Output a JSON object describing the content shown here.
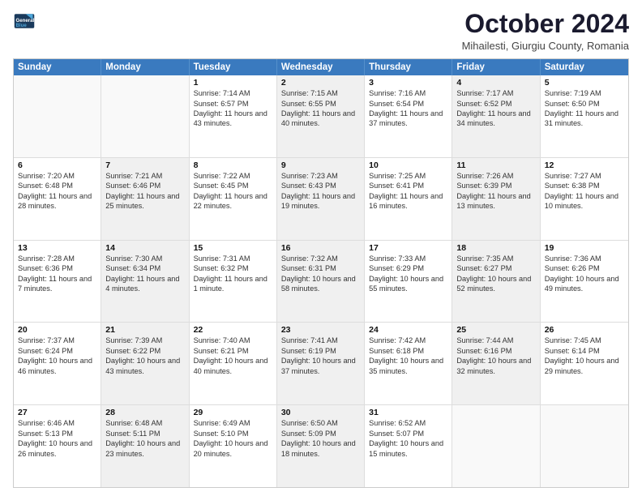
{
  "logo": {
    "line1": "General",
    "line2": "Blue"
  },
  "title": "October 2024",
  "subtitle": "Mihailesti, Giurgiu County, Romania",
  "header_days": [
    "Sunday",
    "Monday",
    "Tuesday",
    "Wednesday",
    "Thursday",
    "Friday",
    "Saturday"
  ],
  "weeks": [
    [
      {
        "day": "",
        "sunrise": "",
        "sunset": "",
        "daylight": "",
        "shaded": false,
        "empty": true
      },
      {
        "day": "",
        "sunrise": "",
        "sunset": "",
        "daylight": "",
        "shaded": false,
        "empty": true
      },
      {
        "day": "1",
        "sunrise": "Sunrise: 7:14 AM",
        "sunset": "Sunset: 6:57 PM",
        "daylight": "Daylight: 11 hours and 43 minutes.",
        "shaded": false,
        "empty": false
      },
      {
        "day": "2",
        "sunrise": "Sunrise: 7:15 AM",
        "sunset": "Sunset: 6:55 PM",
        "daylight": "Daylight: 11 hours and 40 minutes.",
        "shaded": true,
        "empty": false
      },
      {
        "day": "3",
        "sunrise": "Sunrise: 7:16 AM",
        "sunset": "Sunset: 6:54 PM",
        "daylight": "Daylight: 11 hours and 37 minutes.",
        "shaded": false,
        "empty": false
      },
      {
        "day": "4",
        "sunrise": "Sunrise: 7:17 AM",
        "sunset": "Sunset: 6:52 PM",
        "daylight": "Daylight: 11 hours and 34 minutes.",
        "shaded": true,
        "empty": false
      },
      {
        "day": "5",
        "sunrise": "Sunrise: 7:19 AM",
        "sunset": "Sunset: 6:50 PM",
        "daylight": "Daylight: 11 hours and 31 minutes.",
        "shaded": false,
        "empty": false
      }
    ],
    [
      {
        "day": "6",
        "sunrise": "Sunrise: 7:20 AM",
        "sunset": "Sunset: 6:48 PM",
        "daylight": "Daylight: 11 hours and 28 minutes.",
        "shaded": false,
        "empty": false
      },
      {
        "day": "7",
        "sunrise": "Sunrise: 7:21 AM",
        "sunset": "Sunset: 6:46 PM",
        "daylight": "Daylight: 11 hours and 25 minutes.",
        "shaded": true,
        "empty": false
      },
      {
        "day": "8",
        "sunrise": "Sunrise: 7:22 AM",
        "sunset": "Sunset: 6:45 PM",
        "daylight": "Daylight: 11 hours and 22 minutes.",
        "shaded": false,
        "empty": false
      },
      {
        "day": "9",
        "sunrise": "Sunrise: 7:23 AM",
        "sunset": "Sunset: 6:43 PM",
        "daylight": "Daylight: 11 hours and 19 minutes.",
        "shaded": true,
        "empty": false
      },
      {
        "day": "10",
        "sunrise": "Sunrise: 7:25 AM",
        "sunset": "Sunset: 6:41 PM",
        "daylight": "Daylight: 11 hours and 16 minutes.",
        "shaded": false,
        "empty": false
      },
      {
        "day": "11",
        "sunrise": "Sunrise: 7:26 AM",
        "sunset": "Sunset: 6:39 PM",
        "daylight": "Daylight: 11 hours and 13 minutes.",
        "shaded": true,
        "empty": false
      },
      {
        "day": "12",
        "sunrise": "Sunrise: 7:27 AM",
        "sunset": "Sunset: 6:38 PM",
        "daylight": "Daylight: 11 hours and 10 minutes.",
        "shaded": false,
        "empty": false
      }
    ],
    [
      {
        "day": "13",
        "sunrise": "Sunrise: 7:28 AM",
        "sunset": "Sunset: 6:36 PM",
        "daylight": "Daylight: 11 hours and 7 minutes.",
        "shaded": false,
        "empty": false
      },
      {
        "day": "14",
        "sunrise": "Sunrise: 7:30 AM",
        "sunset": "Sunset: 6:34 PM",
        "daylight": "Daylight: 11 hours and 4 minutes.",
        "shaded": true,
        "empty": false
      },
      {
        "day": "15",
        "sunrise": "Sunrise: 7:31 AM",
        "sunset": "Sunset: 6:32 PM",
        "daylight": "Daylight: 11 hours and 1 minute.",
        "shaded": false,
        "empty": false
      },
      {
        "day": "16",
        "sunrise": "Sunrise: 7:32 AM",
        "sunset": "Sunset: 6:31 PM",
        "daylight": "Daylight: 10 hours and 58 minutes.",
        "shaded": true,
        "empty": false
      },
      {
        "day": "17",
        "sunrise": "Sunrise: 7:33 AM",
        "sunset": "Sunset: 6:29 PM",
        "daylight": "Daylight: 10 hours and 55 minutes.",
        "shaded": false,
        "empty": false
      },
      {
        "day": "18",
        "sunrise": "Sunrise: 7:35 AM",
        "sunset": "Sunset: 6:27 PM",
        "daylight": "Daylight: 10 hours and 52 minutes.",
        "shaded": true,
        "empty": false
      },
      {
        "day": "19",
        "sunrise": "Sunrise: 7:36 AM",
        "sunset": "Sunset: 6:26 PM",
        "daylight": "Daylight: 10 hours and 49 minutes.",
        "shaded": false,
        "empty": false
      }
    ],
    [
      {
        "day": "20",
        "sunrise": "Sunrise: 7:37 AM",
        "sunset": "Sunset: 6:24 PM",
        "daylight": "Daylight: 10 hours and 46 minutes.",
        "shaded": false,
        "empty": false
      },
      {
        "day": "21",
        "sunrise": "Sunrise: 7:39 AM",
        "sunset": "Sunset: 6:22 PM",
        "daylight": "Daylight: 10 hours and 43 minutes.",
        "shaded": true,
        "empty": false
      },
      {
        "day": "22",
        "sunrise": "Sunrise: 7:40 AM",
        "sunset": "Sunset: 6:21 PM",
        "daylight": "Daylight: 10 hours and 40 minutes.",
        "shaded": false,
        "empty": false
      },
      {
        "day": "23",
        "sunrise": "Sunrise: 7:41 AM",
        "sunset": "Sunset: 6:19 PM",
        "daylight": "Daylight: 10 hours and 37 minutes.",
        "shaded": true,
        "empty": false
      },
      {
        "day": "24",
        "sunrise": "Sunrise: 7:42 AM",
        "sunset": "Sunset: 6:18 PM",
        "daylight": "Daylight: 10 hours and 35 minutes.",
        "shaded": false,
        "empty": false
      },
      {
        "day": "25",
        "sunrise": "Sunrise: 7:44 AM",
        "sunset": "Sunset: 6:16 PM",
        "daylight": "Daylight: 10 hours and 32 minutes.",
        "shaded": true,
        "empty": false
      },
      {
        "day": "26",
        "sunrise": "Sunrise: 7:45 AM",
        "sunset": "Sunset: 6:14 PM",
        "daylight": "Daylight: 10 hours and 29 minutes.",
        "shaded": false,
        "empty": false
      }
    ],
    [
      {
        "day": "27",
        "sunrise": "Sunrise: 6:46 AM",
        "sunset": "Sunset: 5:13 PM",
        "daylight": "Daylight: 10 hours and 26 minutes.",
        "shaded": false,
        "empty": false
      },
      {
        "day": "28",
        "sunrise": "Sunrise: 6:48 AM",
        "sunset": "Sunset: 5:11 PM",
        "daylight": "Daylight: 10 hours and 23 minutes.",
        "shaded": true,
        "empty": false
      },
      {
        "day": "29",
        "sunrise": "Sunrise: 6:49 AM",
        "sunset": "Sunset: 5:10 PM",
        "daylight": "Daylight: 10 hours and 20 minutes.",
        "shaded": false,
        "empty": false
      },
      {
        "day": "30",
        "sunrise": "Sunrise: 6:50 AM",
        "sunset": "Sunset: 5:09 PM",
        "daylight": "Daylight: 10 hours and 18 minutes.",
        "shaded": true,
        "empty": false
      },
      {
        "day": "31",
        "sunrise": "Sunrise: 6:52 AM",
        "sunset": "Sunset: 5:07 PM",
        "daylight": "Daylight: 10 hours and 15 minutes.",
        "shaded": false,
        "empty": false
      },
      {
        "day": "",
        "sunrise": "",
        "sunset": "",
        "daylight": "",
        "shaded": true,
        "empty": true
      },
      {
        "day": "",
        "sunrise": "",
        "sunset": "",
        "daylight": "",
        "shaded": false,
        "empty": true
      }
    ]
  ]
}
